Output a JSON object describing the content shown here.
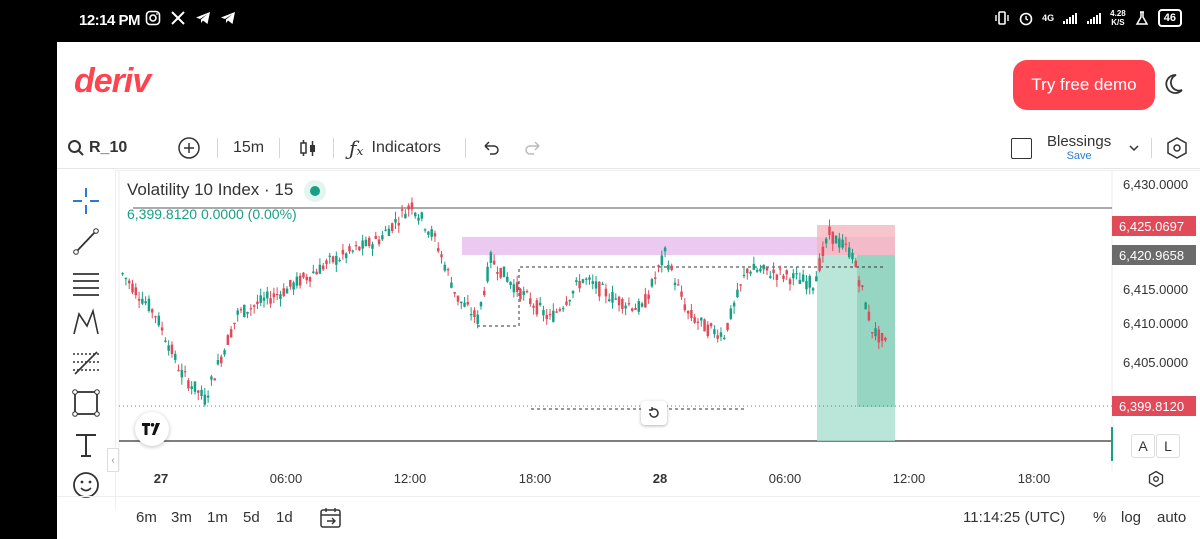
{
  "status_bar": {
    "time": "12:14 PM",
    "net_speed_value": "4.28",
    "net_speed_unit": "K/S",
    "battery": "46",
    "network": "4G"
  },
  "header": {
    "logo": "deriv",
    "demo_button": "Try free demo"
  },
  "toolbar": {
    "symbol": "R_10",
    "interval": "15m",
    "indicators": "Indicators",
    "account_name": "Blessings",
    "account_sub": "Save"
  },
  "chart": {
    "title": "Volatility 10 Index · 15",
    "price_line": "6,399.8120  0.0000 (0.00%)",
    "price_labels": [
      "6,430.0000",
      "6,415.0000",
      "6,410.0000",
      "6,405.0000"
    ],
    "tag_red_top": "6,425.0697",
    "tag_gray": "6,420.9658",
    "tag_red_bottom": "6,399.8120",
    "time_labels": [
      "27",
      "06:00",
      "12:00",
      "18:00",
      "28",
      "06:00",
      "12:00",
      "18:00"
    ],
    "colors": {
      "up": "#16a085",
      "down": "#e14a59",
      "accent": "#ff444f"
    }
  },
  "bottom": {
    "periods": [
      "6m",
      "3m",
      "1m",
      "5d",
      "1d"
    ],
    "clock": "11:14:25 (UTC)",
    "percent": "%",
    "log": "log",
    "auto": "auto"
  },
  "side_buttons": {
    "a": "A",
    "l": "L"
  }
}
